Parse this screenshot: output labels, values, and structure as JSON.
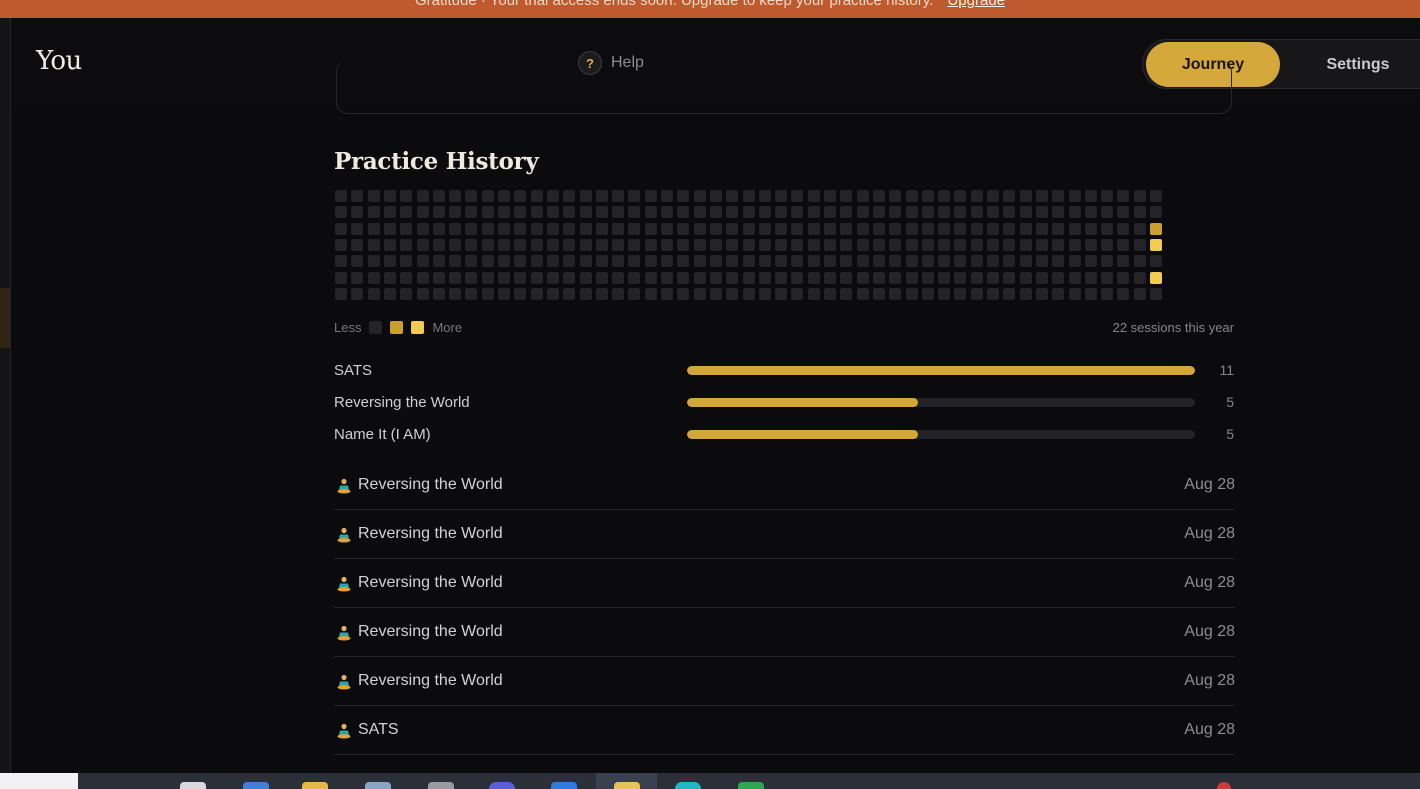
{
  "banner": {
    "text": "Gratitude · Your trial access ends soon. Upgrade to keep your practice history.",
    "link": "Upgrade"
  },
  "header": {
    "brand": "You",
    "help_label": "Help",
    "help_glyph": "?",
    "tabs": {
      "journey": "Journey",
      "settings": "Settings"
    },
    "active_tab": "Journey"
  },
  "practice_history": {
    "title": "Practice History",
    "heatmap": {
      "weeks": 51,
      "days_per_week": 7,
      "active_cells": [
        {
          "week": 50,
          "day": 2,
          "level": 1
        },
        {
          "week": 50,
          "day": 3,
          "level": 2
        },
        {
          "week": 50,
          "day": 5,
          "level": 2
        }
      ],
      "colors": {
        "empty": "#232328",
        "level1": "#c9a02e",
        "level2": "#f2cc50"
      }
    },
    "legend": {
      "less": "Less",
      "more": "More"
    },
    "sessions_summary": "22 sessions this year"
  },
  "practice_bars": [
    {
      "label": "SATS",
      "count": "11",
      "fraction": 1.0
    },
    {
      "label": "Reversing the World",
      "count": "5",
      "fraction": 0.4545
    },
    {
      "label": "Name It (I AM)",
      "count": "5",
      "fraction": 0.4545
    }
  ],
  "sessions": [
    {
      "name": "Reversing the World",
      "date": "Aug 28",
      "icon": "meditation-person-icon"
    },
    {
      "name": "Reversing the World",
      "date": "Aug 28",
      "icon": "meditation-person-icon"
    },
    {
      "name": "Reversing the World",
      "date": "Aug 28",
      "icon": "meditation-person-icon"
    },
    {
      "name": "Reversing the World",
      "date": "Aug 28",
      "icon": "meditation-person-icon"
    },
    {
      "name": "Reversing the World",
      "date": "Aug 28",
      "icon": "meditation-person-icon"
    },
    {
      "name": "SATS",
      "date": "Aug 28",
      "icon": "meditation-person-icon"
    }
  ],
  "colors": {
    "accent": "#d4a83a",
    "banner": "#bf5a2e",
    "background": "#0b0b0d"
  }
}
